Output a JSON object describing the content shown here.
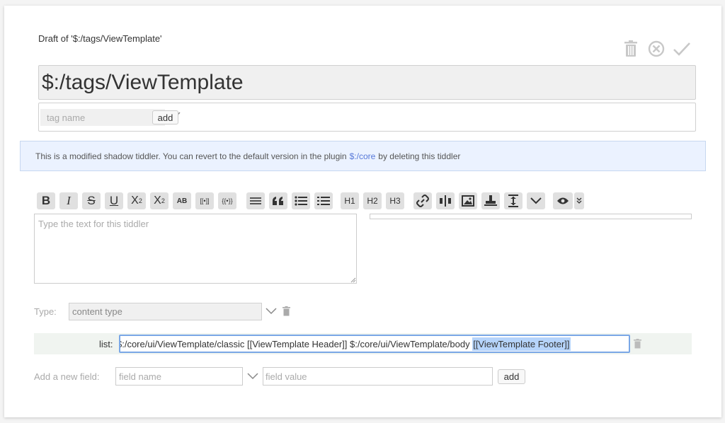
{
  "draft": {
    "title": "Draft of '$:/tags/ViewTemplate'"
  },
  "actions": {
    "delete": "trash-icon",
    "cancel": "close-circle-icon",
    "done": "checkmark-icon"
  },
  "tiddler": {
    "title": "$:/tags/ViewTemplate"
  },
  "tags": {
    "placeholder": "tag name",
    "add_label": "add"
  },
  "notice": {
    "text_before": "This is a modified shadow tiddler. You can revert to the default version in the plugin",
    "plugin": "$:/core",
    "text_after": "by deleting this tiddler"
  },
  "toolbar": {
    "bold": "B",
    "italic": "I",
    "strike": "S",
    "underline": "U",
    "superscript": "X",
    "sup_mark": "2",
    "subscript": "X",
    "sub_mark": "2",
    "smallcaps": "AB",
    "link_tpl": "[[•]]",
    "transclude": "{{•}}",
    "h1": "H1",
    "h2": "H2",
    "h3": "H3"
  },
  "editor": {
    "placeholder": "Type the text for this tiddler"
  },
  "type": {
    "label": "Type:",
    "placeholder": "content type"
  },
  "list_field": {
    "label": "list:",
    "value_plain": "$:/core/ui/ViewTemplate/classic [[ViewTemplate Header]] $:/core/ui/ViewTemplate/body ",
    "value_selected": "[[ViewTemplate Footer]]"
  },
  "new_field": {
    "label": "Add a new field:",
    "name_placeholder": "field name",
    "value_placeholder": "field value",
    "add_label": "add"
  },
  "colors": {
    "accent_link": "#5778d8",
    "notice_bg": "#ebf2ff",
    "selection": "#b6d4fb"
  }
}
